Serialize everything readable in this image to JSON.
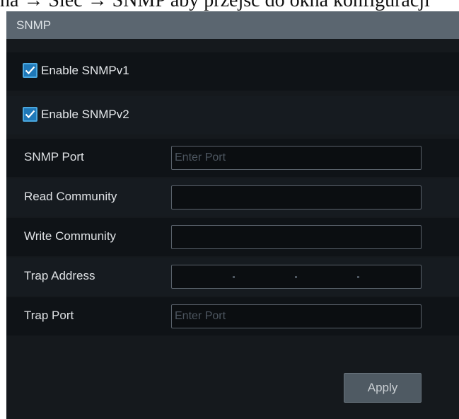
{
  "document_text": "na → Sieć → SNMP aby przejść do okna konfiguracji",
  "window": {
    "title": "SNMP"
  },
  "options": [
    {
      "label": "Enable SNMPv1",
      "checked": true
    },
    {
      "label": "Enable SNMPv2",
      "checked": true
    }
  ],
  "fields": {
    "snmp_port": {
      "label": "SNMP Port",
      "value": "",
      "placeholder": "Enter Port"
    },
    "read_community": {
      "label": "Read Community",
      "value": ""
    },
    "write_community": {
      "label": "Write Community",
      "value": ""
    },
    "trap_address": {
      "label": "Trap Address",
      "value": ""
    },
    "trap_port": {
      "label": "Trap Port",
      "value": "",
      "placeholder": "Enter Port"
    }
  },
  "buttons": {
    "apply": "Apply"
  },
  "colors": {
    "accent": "#1f78b8",
    "titlebar": "#5b6670",
    "panel": "#15191d"
  },
  "icons": {
    "checkmark": "check-icon"
  }
}
